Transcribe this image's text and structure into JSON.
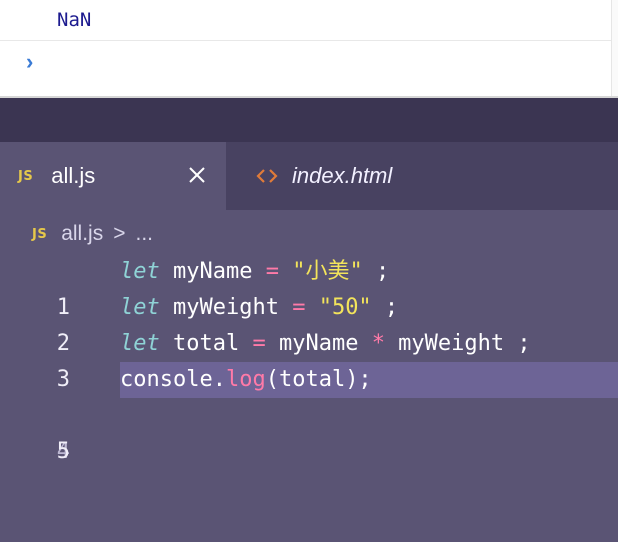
{
  "console": {
    "output_value": "NaN",
    "prompt_symbol": "›"
  },
  "tabs": [
    {
      "badge": "JS",
      "label": "all.js",
      "active": true
    },
    {
      "label": "index.html",
      "active": false
    }
  ],
  "breadcrumb": {
    "badge": "JS",
    "file": "all.js",
    "separator": ">",
    "more": "..."
  },
  "code": {
    "line_numbers": [
      "1",
      "2",
      "3",
      "4",
      "5"
    ],
    "line1": {
      "kw": "let",
      "var": " myName ",
      "op": "=",
      "str": " \"小美\"",
      "end": " ;"
    },
    "line2": {
      "kw": "let",
      "var": " myWeight ",
      "op": "=",
      "str": " \"50\"",
      "end": " ;"
    },
    "line3": {
      "kw": "let",
      "var": " total ",
      "op": "=",
      "mid": " myName ",
      "op2": "*",
      "end": " myWeight ;"
    },
    "line4": {
      "obj": "console.",
      "fn": "log",
      "args": "(total);"
    }
  },
  "colors": {
    "editor_bg": "#5a5474",
    "tabbar_bg": "#3b3552",
    "keyword": "#8fd3d6",
    "string": "#f3e45b",
    "operator": "#ff7aa8",
    "js_badge": "#e6c84a",
    "current_line": "#6d6496"
  }
}
